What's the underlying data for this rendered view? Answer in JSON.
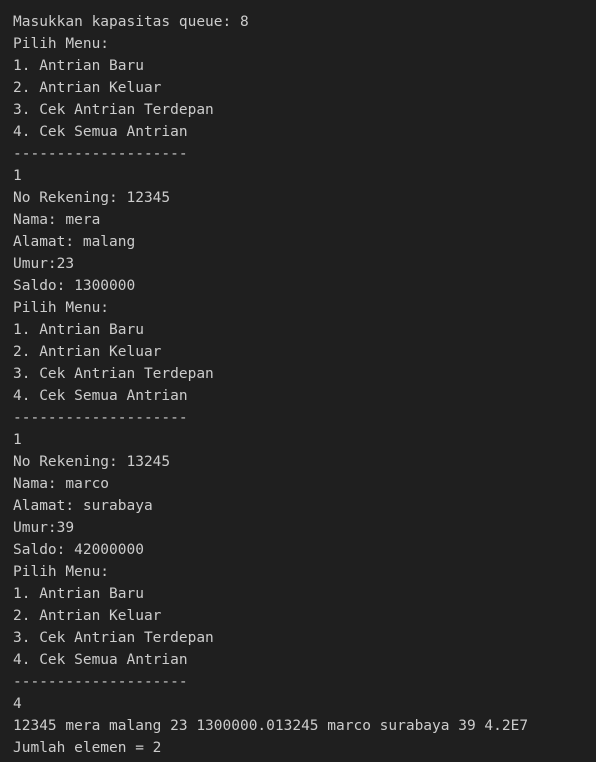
{
  "terminal": {
    "lines": [
      "Masukkan kapasitas queue: 8",
      "Pilih Menu:",
      "1. Antrian Baru",
      "2. Antrian Keluar",
      "3. Cek Antrian Terdepan",
      "4. Cek Semua Antrian",
      "--------------------",
      "1",
      "No Rekening: 12345",
      "Nama: mera",
      "Alamat: malang",
      "Umur:23",
      "Saldo: 1300000",
      "Pilih Menu:",
      "1. Antrian Baru",
      "2. Antrian Keluar",
      "3. Cek Antrian Terdepan",
      "4. Cek Semua Antrian",
      "--------------------",
      "1",
      "No Rekening: 13245",
      "Nama: marco",
      "Alamat: surabaya",
      "Umur:39",
      "Saldo: 42000000",
      "Pilih Menu:",
      "1. Antrian Baru",
      "2. Antrian Keluar",
      "3. Cek Antrian Terdepan",
      "4. Cek Semua Antrian",
      "--------------------",
      "4",
      "12345 mera malang 23 1300000.013245 marco surabaya 39 4.2E7",
      "Jumlah elemen = 2"
    ]
  },
  "colors": {
    "background": "#1f1f1f",
    "text": "#cccccc"
  }
}
